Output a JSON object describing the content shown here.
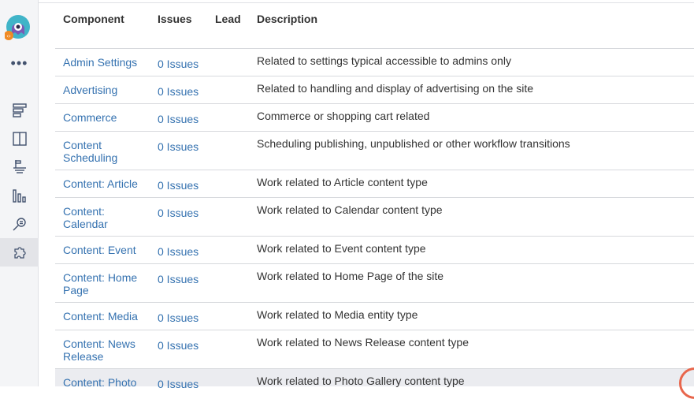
{
  "table": {
    "headers": {
      "component": "Component",
      "issues": "Issues",
      "lead": "Lead",
      "description": "Description"
    },
    "rows": [
      {
        "component": "Admin Settings",
        "issues": "0 Issues",
        "lead": "",
        "description": "Related to settings typical accessible to admins only"
      },
      {
        "component": "Advertising",
        "issues": "0 Issues",
        "lead": "",
        "description": "Related to handling and display of advertising on the site"
      },
      {
        "component": "Commerce",
        "issues": "0 Issues",
        "lead": "",
        "description": "Commerce or shopping cart related"
      },
      {
        "component": "Content Scheduling",
        "issues": "0 Issues",
        "lead": "",
        "description": "Scheduling publishing, unpublished or other workflow transitions"
      },
      {
        "component": "Content: Article",
        "issues": "0 Issues",
        "lead": "",
        "description": "Work related to Article content type"
      },
      {
        "component": "Content: Calendar",
        "issues": "0 Issues",
        "lead": "",
        "description": "Work related to Calendar content type"
      },
      {
        "component": "Content: Event",
        "issues": "0 Issues",
        "lead": "",
        "description": "Work related to Event content type"
      },
      {
        "component": "Content: Home Page",
        "issues": "0 Issues",
        "lead": "",
        "description": "Work related to Home Page of the site"
      },
      {
        "component": "Content: Media",
        "issues": "0 Issues",
        "lead": "",
        "description": "Work related to Media entity type"
      },
      {
        "component": "Content: News Release",
        "issues": "0 Issues",
        "lead": "",
        "description": "Work related to News Release content type"
      },
      {
        "component": "Content: Photo",
        "issues": "0 Issues",
        "lead": "",
        "description": "Work related to Photo Gallery content type"
      }
    ]
  },
  "sidebar": {
    "more_label": "•••",
    "icons": [
      "backlog-icon",
      "board-icon",
      "releases-icon",
      "reports-icon",
      "issues-search-icon",
      "add-ons-icon"
    ],
    "active": "add-ons-icon"
  },
  "colors": {
    "link": "#3572b0",
    "text": "#333333",
    "sidebar_bg": "#f4f5f7",
    "row_highlight": "#ebecf0",
    "spinner": "#e8664c"
  }
}
